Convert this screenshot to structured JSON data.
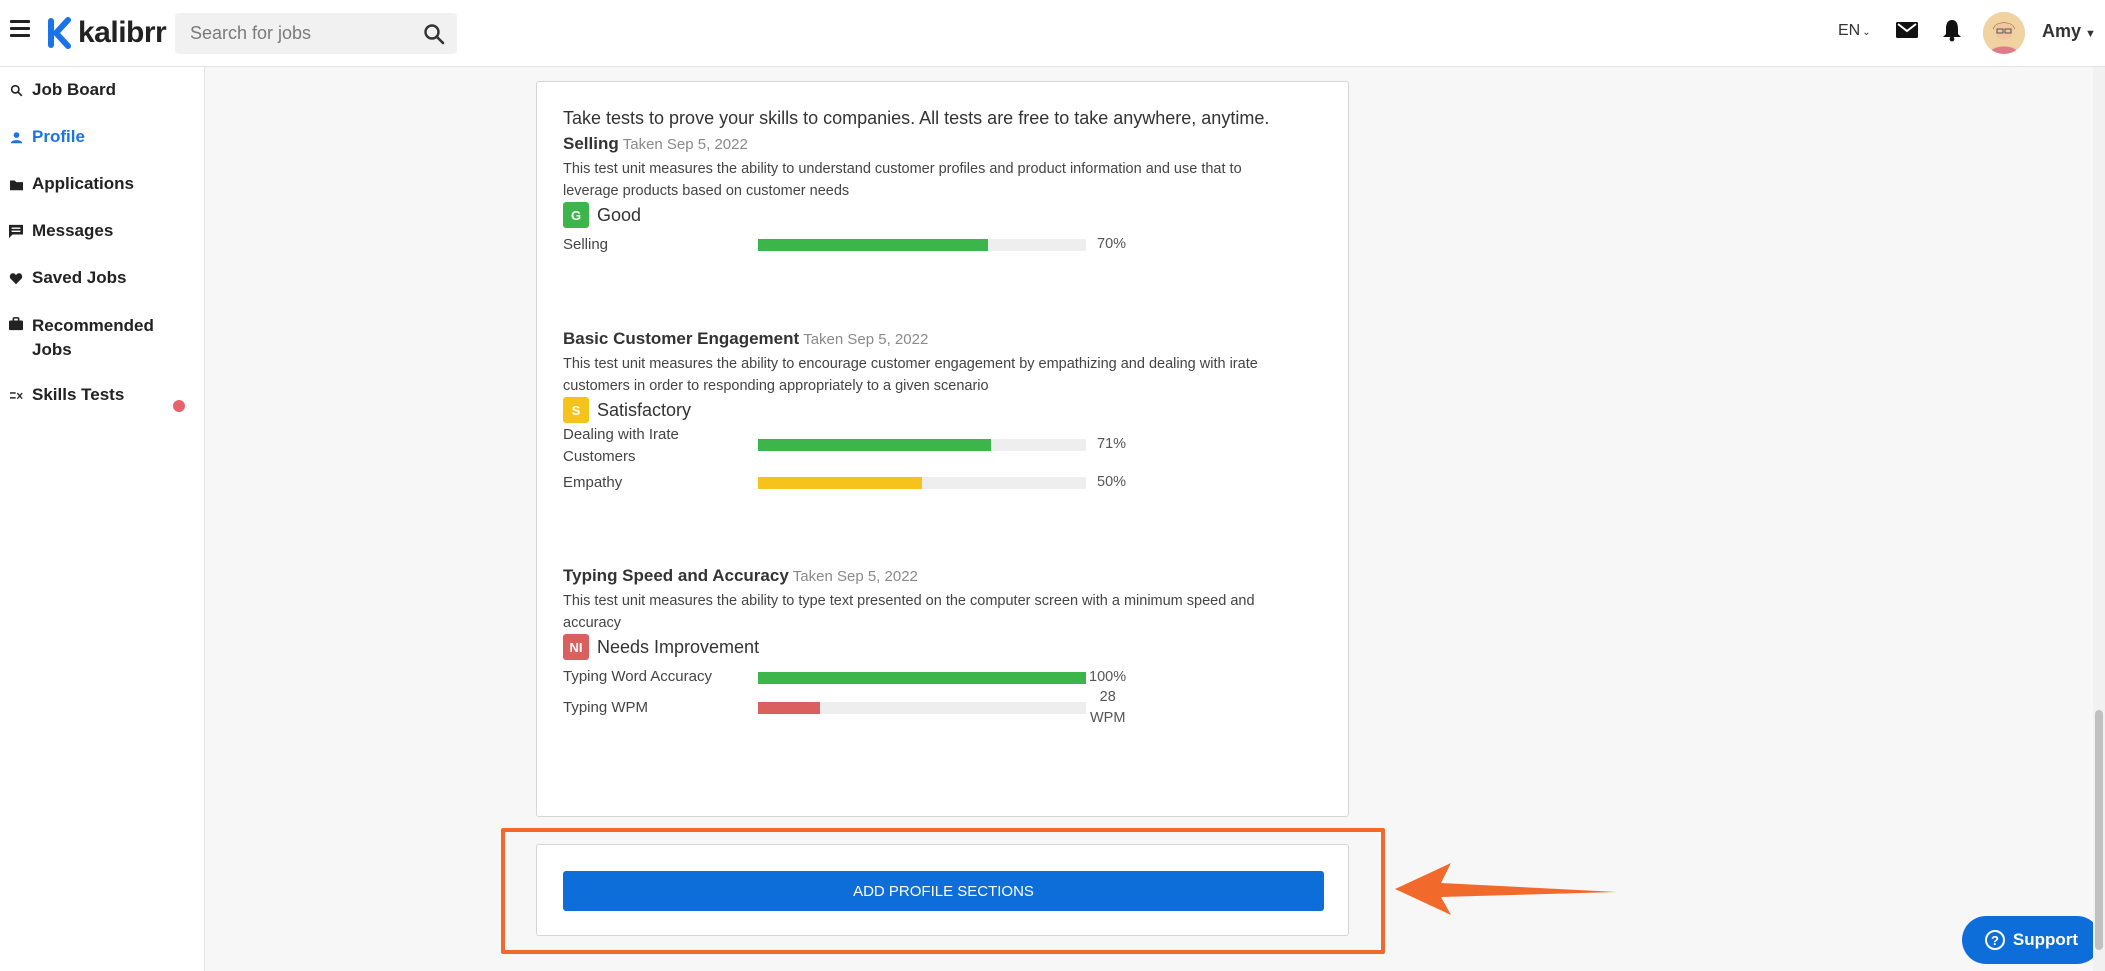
{
  "header": {
    "logo_text": "kalibrr",
    "search_placeholder": "Search for jobs",
    "language": "EN",
    "user_name": "Amy"
  },
  "sidebar": {
    "items": [
      {
        "label": "Job Board",
        "icon": "search-icon"
      },
      {
        "label": "Profile",
        "icon": "person-icon",
        "active": true
      },
      {
        "label": "Applications",
        "icon": "folder-icon"
      },
      {
        "label": "Messages",
        "icon": "message-icon"
      },
      {
        "label": "Saved Jobs",
        "icon": "heart-icon"
      },
      {
        "label": "Recommended",
        "label_line2": "Jobs",
        "icon": "briefcase-icon",
        "has_notification_dot": true
      },
      {
        "label": "Skills Tests",
        "icon": "skills-icon"
      }
    ]
  },
  "skills": {
    "intro": "Take tests to prove your skills to companies. All tests are free to take anywhere, anytime.",
    "tests": [
      {
        "title": "Selling",
        "taken": "Taken Sep 5, 2022",
        "description_line1": "This test unit measures the ability to understand customer profiles and product information and use that to",
        "description_line2": "leverage products based on customer needs",
        "grade_code": "G",
        "grade_label": "Good",
        "grade_color": "#3cb64a",
        "metrics": [
          {
            "label": "Selling",
            "value": "70%",
            "fraction": 0.7,
            "color": "#3cb64a"
          }
        ]
      },
      {
        "title": "Basic Customer Engagement",
        "taken": "Taken Sep 5, 2022",
        "description_line1": "This test unit measures the ability to encourage customer engagement by empathizing and dealing with irate",
        "description_line2": "customers in order to responding appropriately to a given scenario",
        "grade_code": "S",
        "grade_label": "Satisfactory",
        "grade_color": "#f6c21c",
        "metrics": [
          {
            "label_line1": "Dealing with Irate",
            "label_line2": "Customers",
            "value": "71%",
            "fraction": 0.71,
            "color": "#3cb64a"
          },
          {
            "label": "Empathy",
            "value": "50%",
            "fraction": 0.5,
            "color": "#f6c21c"
          }
        ]
      },
      {
        "title": "Typing Speed and Accuracy",
        "taken": "Taken Sep 5, 2022",
        "description_line1": "This test unit measures the ability to type text presented on the computer screen with a minimum speed and",
        "description_line2": "accuracy",
        "grade_code": "NI",
        "grade_label": "Needs Improvement",
        "grade_color": "#d9605f",
        "metrics": [
          {
            "label": "Typing Word Accuracy",
            "value": "100%",
            "fraction": 1.0,
            "color": "#3cb64a"
          },
          {
            "label": "Typing WPM",
            "value_line1": "28",
            "value_line2": "WPM",
            "fraction": 0.19,
            "color": "#d9605f"
          }
        ]
      }
    ]
  },
  "add_sections_button": "ADD PROFILE SECTIONS",
  "support_label": "Support",
  "colors": {
    "brand_blue": "#0d6ed9",
    "highlight_orange": "#f26a2b"
  }
}
